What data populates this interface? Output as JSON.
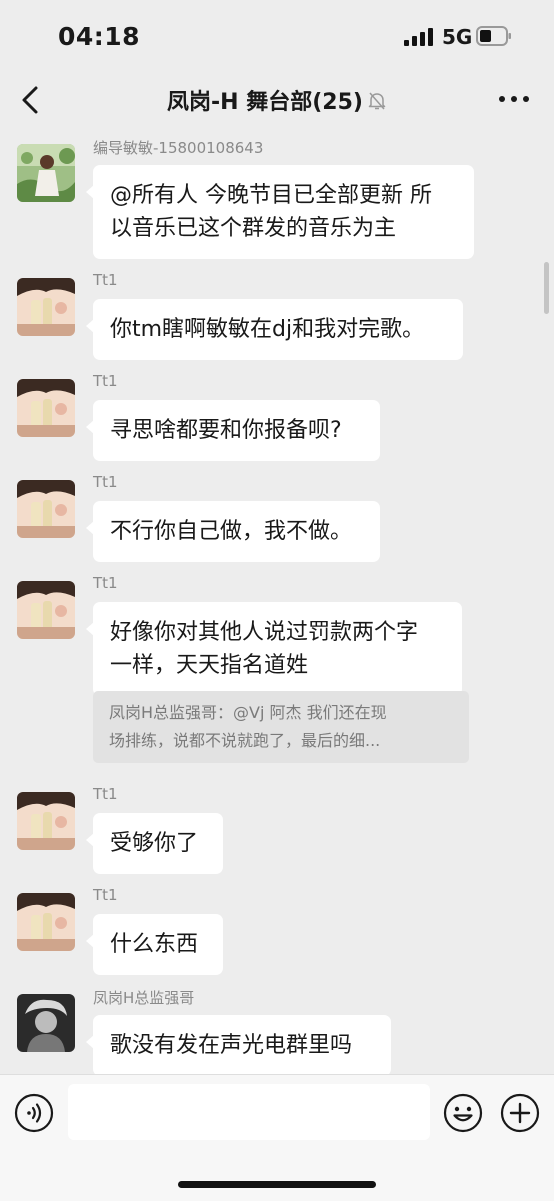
{
  "status": {
    "time": "04:18",
    "network": "5G"
  },
  "header": {
    "title": "凤岗-H 舞台部(25)"
  },
  "messages": [
    {
      "sender": "编导敏敏-15800108643",
      "lines": [
        "@所有人 今晚节目已全部更新 所",
        "以音乐已这个群发的音乐为主"
      ]
    },
    {
      "sender": "Tt1",
      "lines": [
        "你tm瞎啊敏敏在dj和我对完歌。"
      ]
    },
    {
      "sender": "Tt1",
      "lines": [
        "寻思啥都要和你报备呗?"
      ]
    },
    {
      "sender": "Tt1",
      "lines": [
        "不行你自己做，我不做。"
      ]
    },
    {
      "sender": "Tt1",
      "lines": [
        "好像你对其他人说过罚款两个字",
        "一样，天天指名道姓"
      ],
      "quote": [
        "凤岗H总监强哥：@Vj 阿杰 我们还在现",
        "场排练，说都不说就跑了，最后的细..."
      ]
    },
    {
      "sender": "Tt1",
      "lines": [
        "受够你了"
      ]
    },
    {
      "sender": "Tt1",
      "lines": [
        "什么东西"
      ]
    },
    {
      "sender": "凤岗H总监强哥",
      "lines": [
        "歌没有发在声光电群里吗"
      ]
    }
  ],
  "icons": {
    "back": "chevron-left-icon",
    "mute": "bell-off-icon",
    "more": "more-dots-icon",
    "voice": "voice-icon",
    "emoji": "emoji-icon",
    "plus": "plus-icon"
  },
  "colors": {
    "background": "#ededed",
    "bubble": "#ffffff",
    "quote": "#e2e2e2",
    "sender": "#8a8a8a"
  }
}
